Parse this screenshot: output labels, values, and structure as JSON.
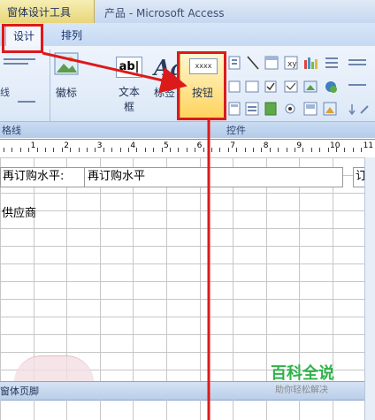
{
  "title_bar": {
    "context_tab": "窗体设计工具",
    "app_title": "产品 - Microsoft Access"
  },
  "tabs": [
    {
      "label": "设计",
      "selected": true
    },
    {
      "label": "排列",
      "selected": false
    }
  ],
  "ribbon": {
    "logo_label": "徽标",
    "text_box_label": "文本\n框",
    "label_label": "标签",
    "button_label": "按钮",
    "button_icon_text": "xxxx",
    "text_box_icon_text": "ab|",
    "label_icon_text": "Aa",
    "group_gridlines": "格线",
    "group_controls": "控件"
  },
  "ruler": {
    "numbers": [
      "1",
      "2",
      "3",
      "4",
      "5",
      "6",
      "7",
      "8",
      "9",
      "10",
      "11"
    ]
  },
  "form": {
    "reorder_label": "再订购水平:",
    "reorder_value": "再订购水平",
    "cut_text": "订",
    "supplier": "供应商",
    "footer_section": "窗体页脚"
  },
  "watermark": {
    "title": "百科全说",
    "subtitle": "助你轻松解决"
  },
  "colors": {
    "highlight": "#dc1a1a",
    "context_tab": "#e9d67a",
    "button_highlight": "#ffd35a"
  }
}
